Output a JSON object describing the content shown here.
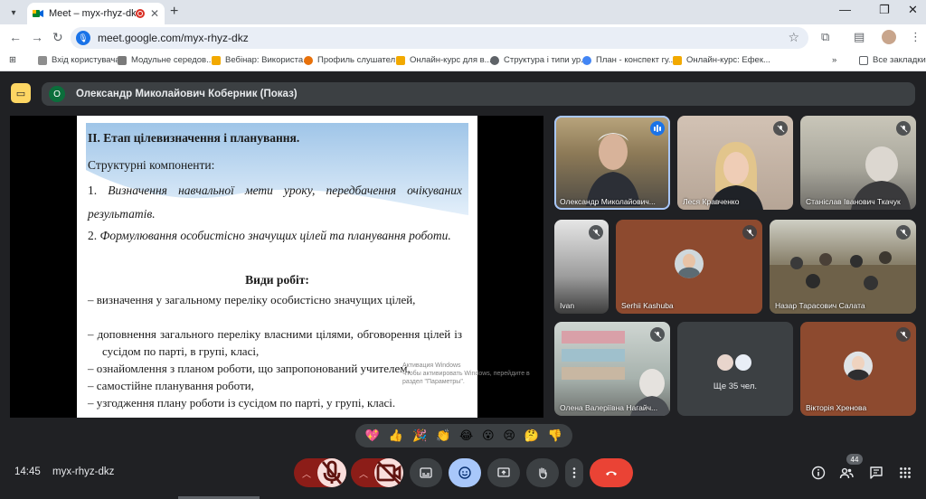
{
  "browser": {
    "tab_title": "Meet – myx-rhyz-dkz",
    "url": "meet.google.com/myx-rhyz-dkz",
    "bookmarks": [
      {
        "label": "Вхід користувача",
        "color": "#8e8e8e"
      },
      {
        "label": "Модульне середов...",
        "color": "#7a7a7a"
      },
      {
        "label": "Вебінар: Використа...",
        "color": "#f2a900"
      },
      {
        "label": "Профиль слушател...",
        "color": "#e8710a"
      },
      {
        "label": "Онлайн-курс для в...",
        "color": "#f2a900"
      },
      {
        "label": "Структура і типи ур...",
        "color": "#5f6368"
      },
      {
        "label": "План - конспект гу...",
        "color": "#4285f4"
      },
      {
        "label": "Онлайн-курс: Ефек...",
        "color": "#f2a900"
      }
    ],
    "all_bookmarks": "Все закладки"
  },
  "meet": {
    "presenter_initial": "О",
    "presenter_label": "Олександр Миколайович Коберник (Показ)",
    "slide": {
      "heading": "ІІ. Етап цілевизначення і планування.",
      "subhead": "Структурні компоненти:",
      "steps": [
        {
          "num": "1.",
          "text": "Визначення навчальної мети уроку, передбачення очікуваних результатів."
        },
        {
          "num": "2.",
          "text": "Формулювання особистісно значущих цілей та планування роботи."
        }
      ],
      "works_title": "Види робіт:",
      "works": [
        "– визначення у загальному переліку особистісно значущих цілей,",
        "– доповнення загального переліку власними цілями, обговорення цілей із сусідом по парті, в групі, класі,",
        "– ознайомлення з планом роботи, що запропонований учителем,",
        "– самостійне планування роботи,",
        "– узгодження плану роботи із сусідом по парті, у групі, класі."
      ]
    },
    "watermark_lines": [
      "Активация Windows",
      "Чтобы активировать Windows, перейдите в",
      "раздел \"Параметры\"."
    ],
    "participants": [
      {
        "name": "Олександр Миколайович...",
        "state": "speaking"
      },
      {
        "name": "Леся Кравченко",
        "state": "muted"
      },
      {
        "name": "Станіслав Іванович Ткачук",
        "state": "muted"
      },
      {
        "name": "Ivan",
        "state": "muted"
      },
      {
        "name": "Serhii Kashuba",
        "state": "muted"
      },
      {
        "name": "Назар Тарасович Салата",
        "state": "muted"
      },
      {
        "name": "Олена Валеріївна Нагайч...",
        "state": "muted"
      },
      {
        "name": "Ще 35 чел.",
        "state": "more"
      },
      {
        "name": "Вікторія Хренова",
        "state": "muted"
      }
    ],
    "reactions": [
      "💖",
      "👍",
      "🎉",
      "👏",
      "😂",
      "😮",
      "😢",
      "🤔",
      "👎"
    ],
    "time": "14:45",
    "meeting_code": "myx-rhyz-dkz",
    "participant_count": "44"
  },
  "colors": {
    "meet_bg": "#202124",
    "end_call": "#ea4335",
    "muted_red": "#8c1d18",
    "active_blue": "#a8c7fa"
  }
}
